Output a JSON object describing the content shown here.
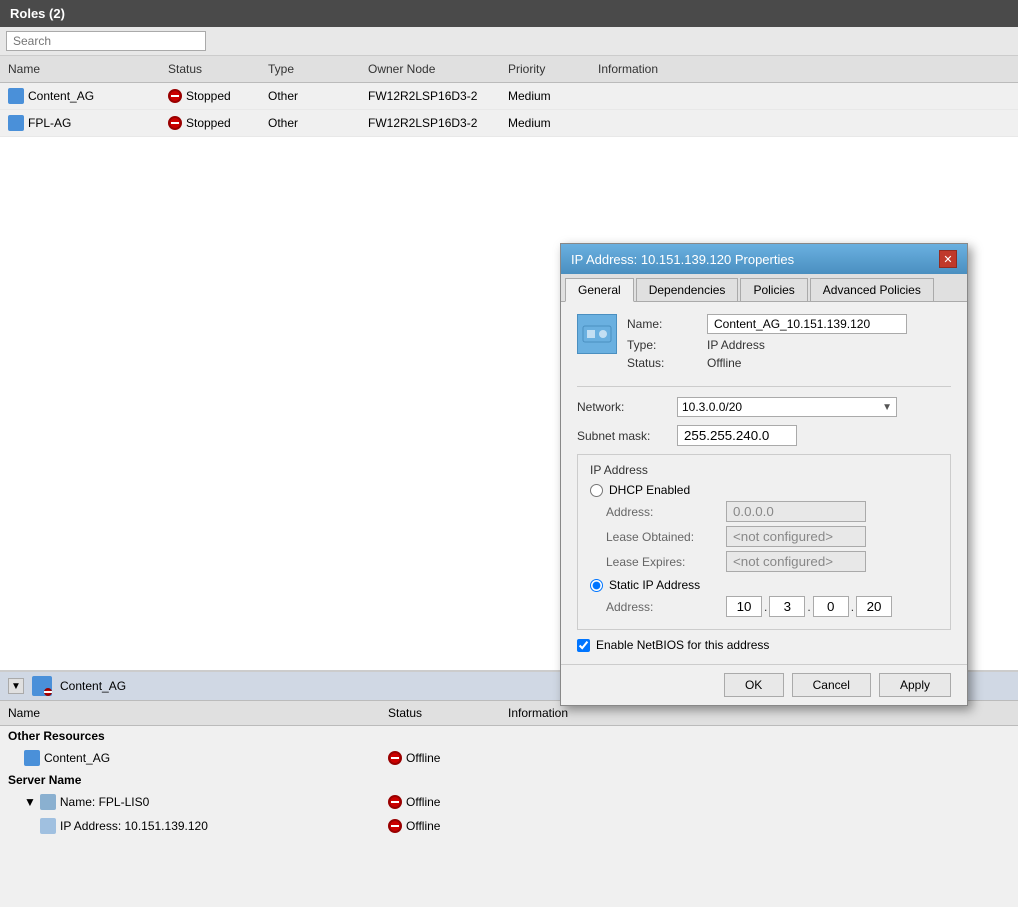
{
  "topPanel": {
    "title": "Roles (2)",
    "search": {
      "placeholder": "Search"
    },
    "columns": [
      "Name",
      "Status",
      "Type",
      "Owner Node",
      "Priority",
      "Information"
    ],
    "rows": [
      {
        "name": "Content_AG",
        "status": "Stopped",
        "type": "Other",
        "ownerNode": "FW12R2LSP16D3-2",
        "priority": "Medium",
        "information": ""
      },
      {
        "name": "FPL-AG",
        "status": "Stopped",
        "type": "Other",
        "ownerNode": "FW12R2LSP16D3-2",
        "priority": "Medium",
        "information": ""
      }
    ]
  },
  "bottomPanel": {
    "headerIcon": "expand",
    "headerTitle": "Content_AG",
    "tableColumns": [
      "Name",
      "Status",
      "Information"
    ],
    "sections": [
      {
        "sectionTitle": "Other Resources",
        "rows": [
          {
            "name": "Content_AG",
            "status": "Offline",
            "information": "",
            "indent": 1
          }
        ]
      },
      {
        "sectionTitle": "Server Name",
        "rows": [
          {
            "name": "Name: FPL-LIS0",
            "status": "Offline",
            "information": "",
            "indent": 1,
            "expandable": true
          },
          {
            "name": "IP Address: 10.151.139.120",
            "status": "Offline",
            "information": "",
            "indent": 2
          }
        ]
      }
    ]
  },
  "dialog": {
    "title": "IP Address: 10.151.139.120 Properties",
    "tabs": [
      "General",
      "Dependencies",
      "Policies",
      "Advanced Policies"
    ],
    "activeTab": "General",
    "resourceName": "Content_AG_10.151.139.120",
    "type": "IP Address",
    "status": "Offline",
    "labels": {
      "name": "Name:",
      "type": "Type:",
      "status": "Status:",
      "network": "Network:",
      "subnetMask": "Subnet mask:",
      "ipAddress": "IP Address",
      "dhcpEnabled": "DHCP Enabled",
      "address": "Address:",
      "leaseObtained": "Lease Obtained:",
      "leaseExpires": "Lease Expires:",
      "staticIP": "Static IP Address",
      "enableNetBIOS": "Enable NetBIOS for this address"
    },
    "network": "10.3.0.0/20",
    "subnetMask": "255.255.240.0",
    "dhcpAddress": "0.0.0.0",
    "dhcpLeaseObtained": "<not configured>",
    "dhcpLeaseExpires": "<not configured>",
    "staticIPOctet1": "10",
    "staticIPOctet2": "3",
    "staticIPOctet3": "0",
    "staticIPOctet4": "20",
    "enableNetBIOS": true,
    "buttons": {
      "ok": "OK",
      "cancel": "Cancel",
      "apply": "Apply"
    }
  }
}
